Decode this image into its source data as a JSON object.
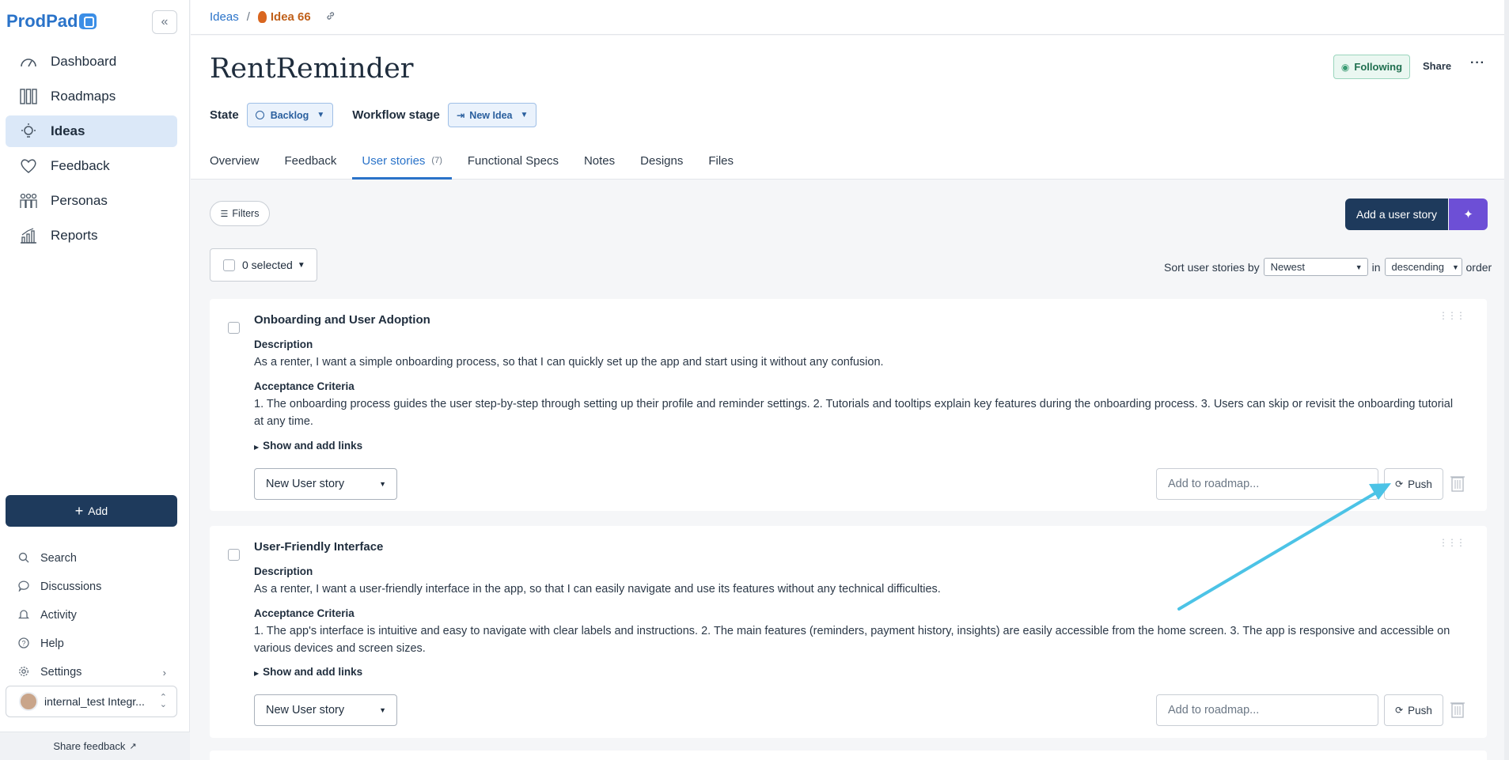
{
  "app": {
    "logo": "ProdPad"
  },
  "sidebar": {
    "nav": [
      {
        "label": "Dashboard",
        "icon": "gauge-icon"
      },
      {
        "label": "Roadmaps",
        "icon": "grid-icon"
      },
      {
        "label": "Ideas",
        "icon": "bulb-icon",
        "active": true
      },
      {
        "label": "Feedback",
        "icon": "heart-icon"
      },
      {
        "label": "Personas",
        "icon": "people-icon"
      },
      {
        "label": "Reports",
        "icon": "chart-icon"
      }
    ],
    "add_label": "Add",
    "utilities": [
      {
        "label": "Search",
        "icon": "search-icon"
      },
      {
        "label": "Discussions",
        "icon": "chat-icon"
      },
      {
        "label": "Activity",
        "icon": "bell-icon"
      },
      {
        "label": "Help",
        "icon": "help-icon"
      },
      {
        "label": "Settings",
        "icon": "gear-icon"
      }
    ],
    "user": "internal_test Integr...",
    "share_feedback": "Share feedback"
  },
  "breadcrumb": {
    "root": "Ideas",
    "separator": "/",
    "current": "Idea 66"
  },
  "idea": {
    "title": "RentReminder",
    "following_label": "Following",
    "share_label": "Share",
    "more_label": "···",
    "state_label": "State",
    "state_value": "Backlog",
    "workflow_label": "Workflow stage",
    "workflow_value": "New Idea"
  },
  "tabs": [
    {
      "label": "Overview"
    },
    {
      "label": "Feedback"
    },
    {
      "label": "User stories",
      "count": "(7)",
      "active": true
    },
    {
      "label": "Functional Specs"
    },
    {
      "label": "Notes"
    },
    {
      "label": "Designs"
    },
    {
      "label": "Files"
    }
  ],
  "toolbar": {
    "filters_label": "Filters",
    "add_story_label": "Add a user story",
    "selected_label": "0 selected",
    "sort_prefix": "Sort user stories by",
    "sort_value": "Newest",
    "sort_in": "in",
    "order_value": "descending",
    "sort_suffix": "order"
  },
  "stories": [
    {
      "title": "Onboarding and User Adoption",
      "description_label": "Description",
      "description": "As a renter, I want a simple onboarding process, so that I can quickly set up the app and start using it without any confusion.",
      "criteria_label": "Acceptance Criteria",
      "criteria": "1. The onboarding process guides the user step-by-step through setting up their profile and reminder settings. 2. Tutorials and tooltips explain key features during the onboarding process. 3. Users can skip or revisit the onboarding tutorial at any time.",
      "links_label": "Show and add links",
      "type_value": "New User story",
      "roadmap_placeholder": "Add to roadmap...",
      "push_label": "Push"
    },
    {
      "title": "User-Friendly Interface",
      "description_label": "Description",
      "description": "As a renter, I want a user-friendly interface in the app, so that I can easily navigate and use its features without any technical difficulties.",
      "criteria_label": "Acceptance Criteria",
      "criteria": "1. The app's interface is intuitive and easy to navigate with clear labels and instructions. 2. The main features (reminders, payment history, insights) are easily accessible from the home screen. 3. The app is responsive and accessible on various devices and screen sizes.",
      "links_label": "Show and add links",
      "type_value": "New User story",
      "roadmap_placeholder": "Add to roadmap...",
      "push_label": "Push"
    }
  ],
  "colors": {
    "accent": "#2a73c9",
    "primary_button": "#1e3a5c",
    "magic_button": "#6d4fd6",
    "annotation_arrow": "#4cc3e6"
  }
}
